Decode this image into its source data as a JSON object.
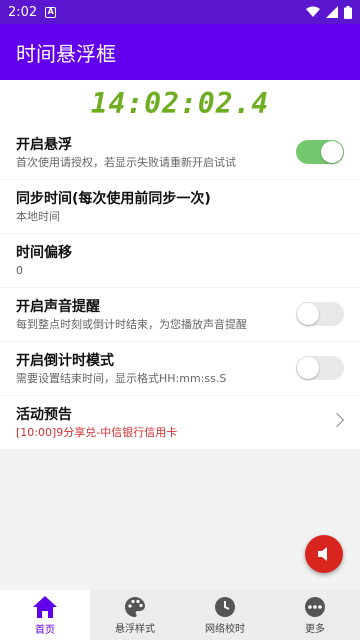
{
  "status_bar": {
    "time": "2:02",
    "notification_letter": "A"
  },
  "app": {
    "title": "时间悬浮框"
  },
  "clock": {
    "display": "14:02:02.4",
    "color": "#6fad21"
  },
  "settings": [
    {
      "title": "开启悬浮",
      "subtitle": "首次使用请授权，若显示失败请重新开启试试",
      "control": "switch",
      "on": true
    },
    {
      "title": "同步时间(每次使用前同步一次)",
      "subtitle": "本地时间"
    },
    {
      "title": "时间偏移",
      "subtitle": "0"
    },
    {
      "title": "开启声音提醒",
      "subtitle": "每到整点时刻或倒计时结束，为您播放声音提醒",
      "control": "switch",
      "on": false
    },
    {
      "title": "开启倒计时模式",
      "subtitle": "需要设置结束时间，显示格式HH:mm:ss.S",
      "control": "switch",
      "on": false
    },
    {
      "title": "活动预告",
      "subtitle": "[10:00]9分享兑-中信银行信用卡",
      "control": "chevron"
    }
  ],
  "fab": {
    "icon": "speaker-icon",
    "color": "#d8261f"
  },
  "bottom_nav": [
    {
      "label": "首页",
      "icon": "home-icon",
      "active": true
    },
    {
      "label": "悬浮样式",
      "icon": "palette-icon",
      "active": false
    },
    {
      "label": "网络校时",
      "icon": "clock-icon",
      "active": false
    },
    {
      "label": "更多",
      "icon": "more-icon",
      "active": false
    }
  ],
  "colors": {
    "status_bar": "#5b16d0",
    "app_bar": "#6200ee",
    "switch_on": "#74c76d",
    "accent": "#6200ee"
  }
}
